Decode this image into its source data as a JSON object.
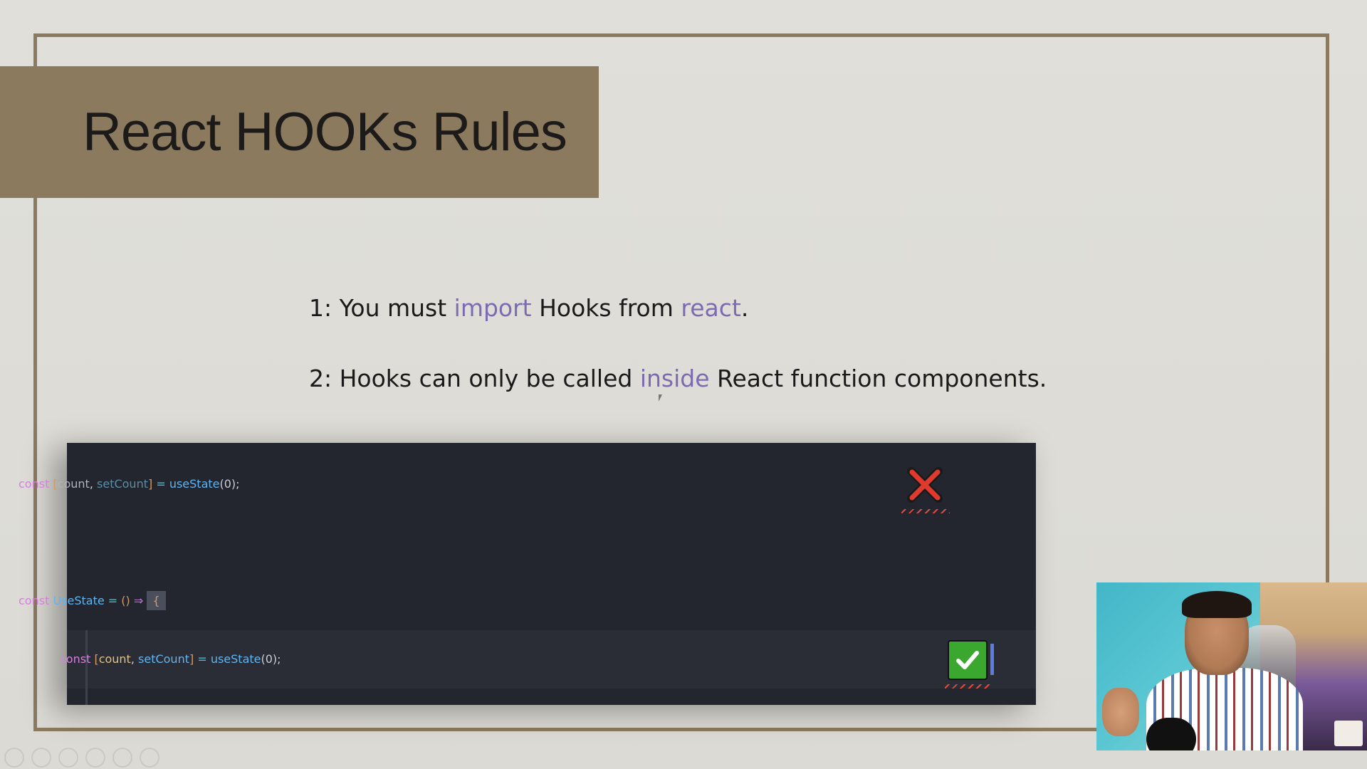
{
  "slide": {
    "title": "React HOOKs Rules",
    "rules": [
      {
        "prefix": "1: You must ",
        "hl1": "import",
        "mid": " Hooks from ",
        "hl2": "react",
        "suffix": "."
      },
      {
        "prefix": "2: Hooks can only be called ",
        "hl1": "inside",
        "suffix": " React function components."
      }
    ]
  },
  "code": {
    "line1": {
      "kw": "const",
      "open": "[",
      "v1": "count",
      "comma": ",",
      "v2": "setCount",
      "close": "]",
      "eq": "=",
      "fn": "useState",
      "args": "(0);",
      "mark": "x-mark-icon"
    },
    "line2": {
      "kw": "const",
      "name": "UseState",
      "eq": "=",
      "parens": "()",
      "arrow": "⇒",
      "brace": "{"
    },
    "line3": {
      "kw": "const",
      "open": "[",
      "v1": "count",
      "comma": ",",
      "v2": "setCount",
      "close": "]",
      "eq": "=",
      "fn": "useState",
      "args": "(0);",
      "mark": "check-mark-icon"
    }
  },
  "colors": {
    "frame": "#8c7a5e",
    "code_bg": "#23262e",
    "highlight_text": "#7a6bb3",
    "check": "#3aa82e",
    "cross": "#e03a2e"
  }
}
